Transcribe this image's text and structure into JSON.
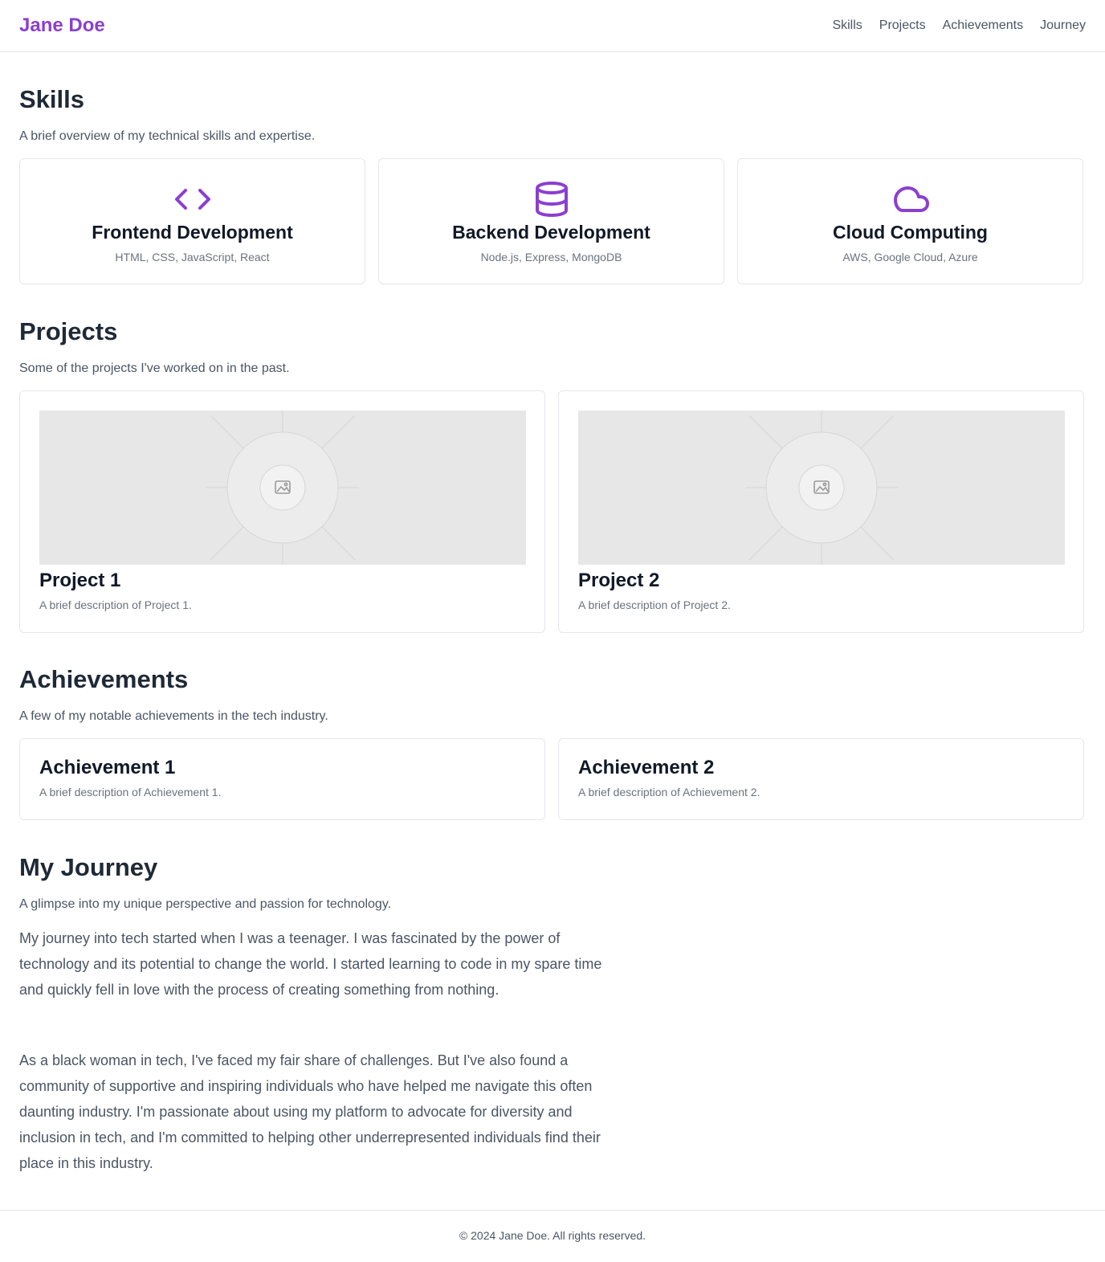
{
  "header": {
    "brand": "Jane Doe",
    "nav": [
      "Skills",
      "Projects",
      "Achievements",
      "Journey"
    ]
  },
  "skills": {
    "title": "Skills",
    "subtitle": "A brief overview of my technical skills and expertise.",
    "items": [
      {
        "icon": "code-icon",
        "title": "Frontend Development",
        "desc": "HTML, CSS, JavaScript, React"
      },
      {
        "icon": "database-icon",
        "title": "Backend Development",
        "desc": "Node.js, Express, MongoDB"
      },
      {
        "icon": "cloud-icon",
        "title": "Cloud Computing",
        "desc": "AWS, Google Cloud, Azure"
      }
    ]
  },
  "projects": {
    "title": "Projects",
    "subtitle": "Some of the projects I've worked on in the past.",
    "items": [
      {
        "title": "Project 1",
        "desc": "A brief description of Project 1."
      },
      {
        "title": "Project 2",
        "desc": "A brief description of Project 2."
      }
    ]
  },
  "achievements": {
    "title": "Achievements",
    "subtitle": "A few of my notable achievements in the tech industry.",
    "items": [
      {
        "title": "Achievement 1",
        "desc": "A brief description of Achievement 1."
      },
      {
        "title": "Achievement 2",
        "desc": "A brief description of Achievement 2."
      }
    ]
  },
  "journey": {
    "title": "My Journey",
    "subtitle": "A glimpse into my unique perspective and passion for technology.",
    "paragraphs": [
      "My journey into tech started when I was a teenager. I was fascinated by the power of technology and its potential to change the world. I started learning to code in my spare time and quickly fell in love with the process of creating something from nothing.",
      "As a black woman in tech, I've faced my fair share of challenges. But I've also found a community of supportive and inspiring individuals who have helped me navigate this often daunting industry. I'm passionate about using my platform to advocate for diversity and inclusion in tech, and I'm committed to helping other underrepresented individuals find their place in this industry."
    ]
  },
  "footer": {
    "text": "© 2024 Jane Doe. All rights reserved."
  },
  "colors": {
    "accent": "#8b3fd0",
    "heading": "#1f2937",
    "muted": "#6b7280",
    "border": "#e5e7eb"
  }
}
